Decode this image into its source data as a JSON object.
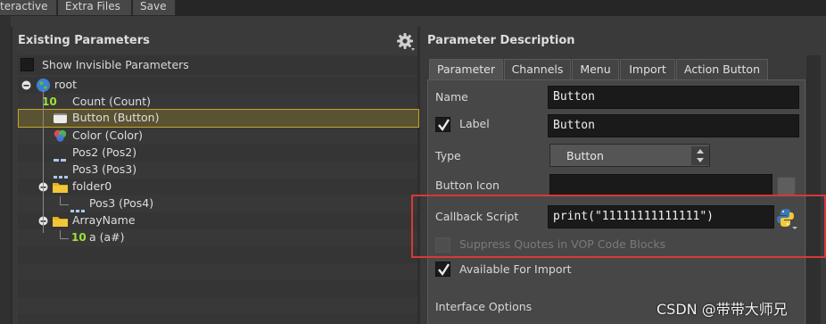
{
  "top_tabs": [
    "teractive",
    "Extra Files",
    "Save"
  ],
  "existing": {
    "title": "Existing Parameters",
    "show_invisible": "Show Invisible Parameters",
    "tree": [
      {
        "label": "root",
        "depth": 0,
        "icon": "globe-icon"
      },
      {
        "label": "Count (Count)",
        "depth": 1,
        "icon": "integer-icon",
        "glyph": "10"
      },
      {
        "label": "Button (Button)",
        "depth": 1,
        "icon": "button-icon",
        "selected": true
      },
      {
        "label": "Color (Color)",
        "depth": 1,
        "icon": "color-icon"
      },
      {
        "label": "Pos2 (Pos2)",
        "depth": 1,
        "icon": "vector2-icon"
      },
      {
        "label": "Pos3 (Pos3)",
        "depth": 1,
        "icon": "vector3-icon"
      },
      {
        "label": "folder0",
        "depth": 1,
        "icon": "folder-icon"
      },
      {
        "label": "Pos3 (Pos4)",
        "depth": 2,
        "icon": "vector3-icon"
      },
      {
        "label": "ArrayName",
        "depth": 1,
        "icon": "folder-icon"
      },
      {
        "label": "a (a#)",
        "depth": 2,
        "icon": "integer-icon",
        "glyph": "10"
      }
    ]
  },
  "description": {
    "title": "Parameter Description",
    "tabs": [
      "Parameter",
      "Channels",
      "Menu",
      "Import",
      "Action Button"
    ],
    "name_label": "Name",
    "name_value": "Button",
    "label_label": "Label",
    "label_value": "Button",
    "type_label": "Type",
    "type_value": "Button",
    "button_icon_label": "Button Icon",
    "callback_label": "Callback Script",
    "callback_value": "print(\"11111111111111\")",
    "suppress_quotes": "Suppress Quotes in VOP Code Blocks",
    "available_import": "Available For Import",
    "interface_options": "Interface Options"
  },
  "watermark": "CSDN @带带大师兄",
  "colors": {
    "selection_border": "#c6a42b",
    "highlight_box": "#d9373b",
    "integer_glyph": "#9fe03a",
    "folder": "#e2b21c",
    "globe_blue": "#3e7fd6",
    "globe_green": "#5cbc3d"
  }
}
